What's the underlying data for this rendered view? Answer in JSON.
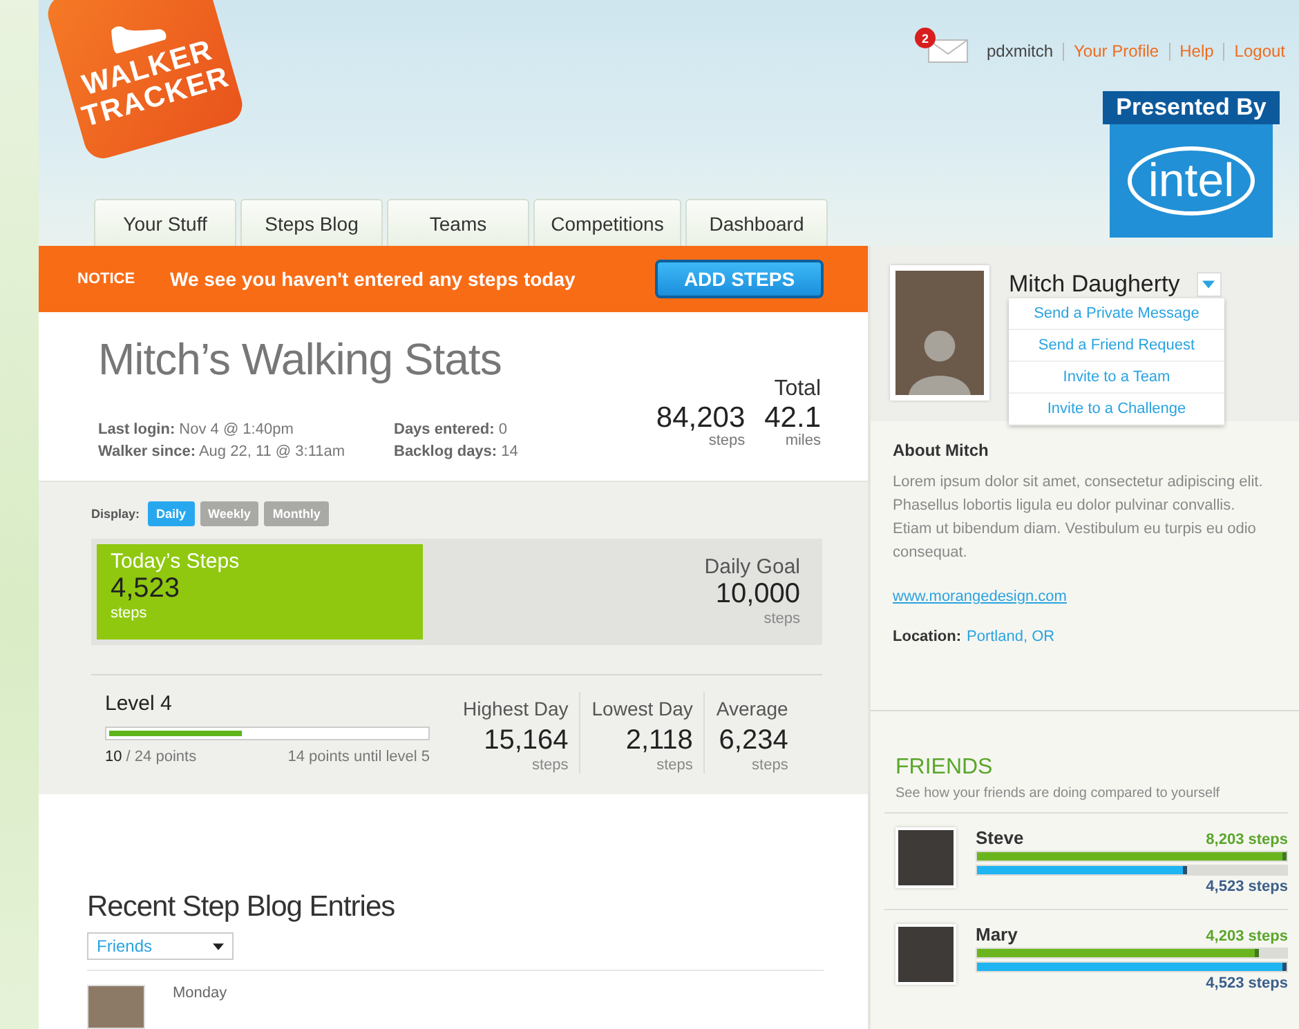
{
  "header": {
    "logo": [
      "WALKER",
      "TRACKER"
    ],
    "mail_count": "2",
    "username": "pdxmitch",
    "links": [
      "Your Profile",
      "Help",
      "Logout"
    ],
    "sponsor": {
      "label": "Presented By",
      "name": "intel"
    }
  },
  "tabs": [
    {
      "label": "Your Stuff",
      "selected": false
    },
    {
      "label": "Steps Blog",
      "selected": false
    },
    {
      "label": "Teams",
      "selected": false
    },
    {
      "label": "Competitions",
      "selected": false
    },
    {
      "label": "Dashboard",
      "selected": false
    }
  ],
  "notice": {
    "tag": "NOTICE",
    "message": "We see you haven't entered any steps today",
    "button": "ADD STEPS"
  },
  "stats": {
    "title": "Mitch’s Walking Stats",
    "info": [
      {
        "label": "Last login:",
        "value": "Nov 4 @ 1:40pm"
      },
      {
        "label": "Walker since:",
        "value": "Aug 22, 11 @ 3:11am"
      },
      {
        "label": "Days entered:",
        "value": "0"
      },
      {
        "label": "Backlog days:",
        "value": "14"
      }
    ],
    "total": {
      "label": "Total",
      "items": [
        {
          "value": "84,203",
          "unit": "steps"
        },
        {
          "value": "42.1",
          "unit": "miles"
        }
      ]
    }
  },
  "display": {
    "label": "Display:",
    "options": [
      {
        "label": "Daily",
        "selected": true
      },
      {
        "label": "Weekly",
        "selected": false
      },
      {
        "label": "Monthly",
        "selected": false
      }
    ]
  },
  "today": {
    "label": "Today’s Steps",
    "value": "4,523",
    "unit": "steps",
    "level": 0.4523,
    "goal_label": "Daily Goal",
    "goal_value": "10,000",
    "goal_unit": "steps"
  },
  "level": {
    "title": "Level 4",
    "level": 0.42,
    "points": "10",
    "points_total": "/ 24 points",
    "remaining": "14 points until level 5"
  },
  "day_stats": [
    {
      "label": "Highest Day",
      "value": "15,164",
      "unit": "steps"
    },
    {
      "label": "Lowest Day",
      "value": "2,118",
      "unit": "steps"
    },
    {
      "label": "Average",
      "value": "6,234",
      "unit": "steps"
    }
  ],
  "blog": {
    "title": "Recent Step Blog Entries",
    "filter": "Friends",
    "entries": [
      {
        "day": "Monday"
      }
    ]
  },
  "profile": {
    "name": "Mitch Daugherty",
    "menu": [
      "Send a Private Message",
      "Send a Friend Request",
      "Invite to a Team",
      "Invite to a Challenge"
    ],
    "about_title": "About Mitch",
    "about": "Lorem ipsum dolor sit amet, consectetur adipiscing elit. Phasellus lobortis ligula eu dolor pulvinar convallis. Etiam ut bibendum diam. Vestibulum eu turpis eu odio consequat.",
    "website": "www.morangedesign.com",
    "location_label": "Location:",
    "location": "Portland, OR"
  },
  "friends": {
    "title": "FRIENDS",
    "subtitle": "See how your friends are doing compared to yourself",
    "items": [
      {
        "name": "Steve",
        "friend_steps": "8,203 steps",
        "friend_bar": {
          "level": 1.0
        },
        "my_bar": {
          "level": 0.68
        },
        "my_steps": "4,523 steps"
      },
      {
        "name": "Mary",
        "friend_steps": "4,203 steps",
        "friend_bar": {
          "level": 0.91
        },
        "my_bar": {
          "level": 1.0
        },
        "my_steps": "4,523 steps"
      }
    ]
  }
}
